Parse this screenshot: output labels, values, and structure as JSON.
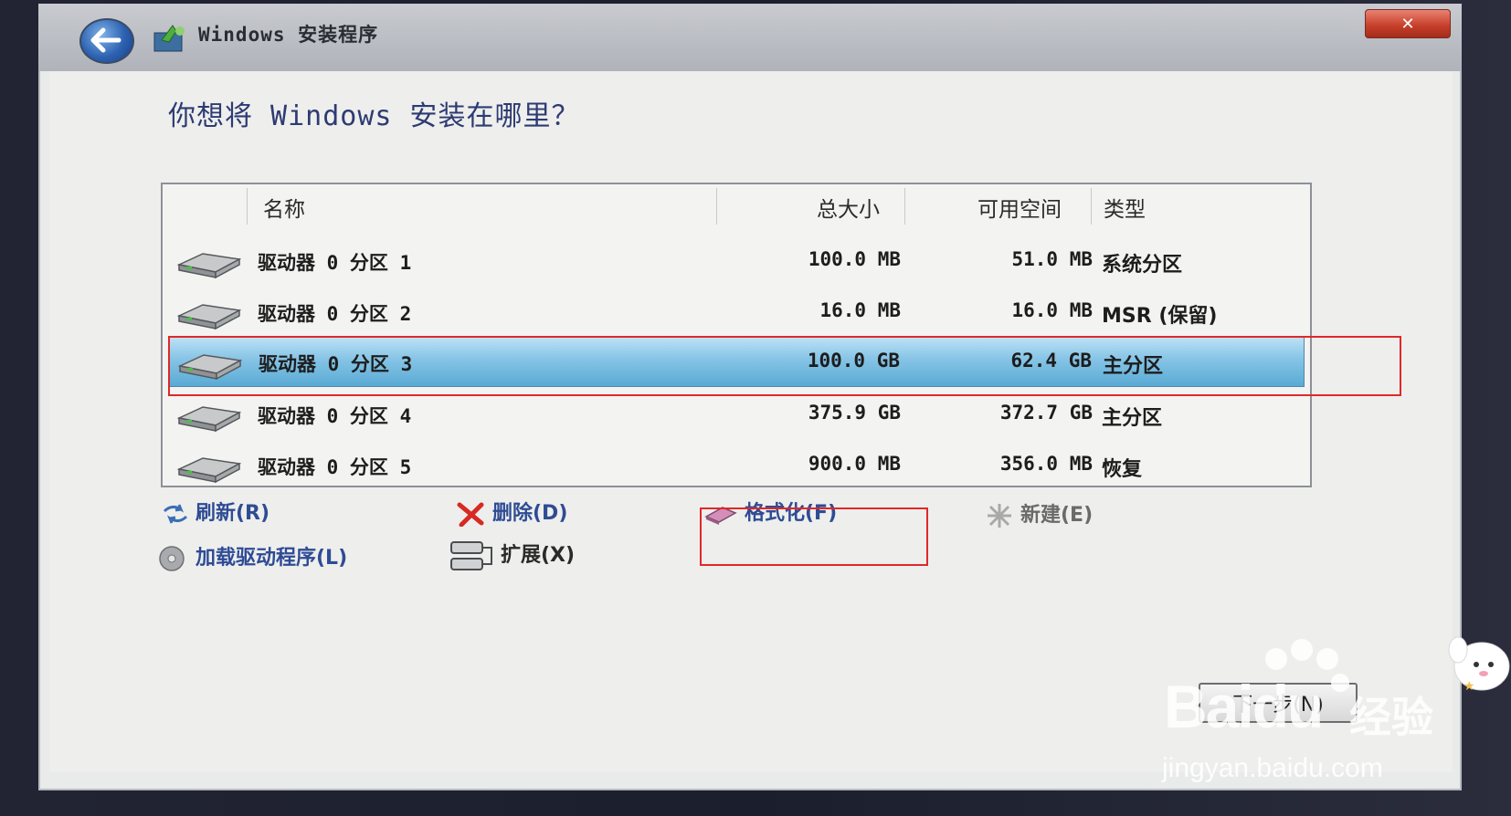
{
  "window": {
    "title": "Windows 安装程序",
    "close_label": "✕"
  },
  "page": {
    "heading": "你想将 Windows 安装在哪里？"
  },
  "table": {
    "columns": {
      "name": "名称",
      "total": "总大小",
      "free": "可用空间",
      "type": "类型"
    },
    "rows": [
      {
        "name": "驱动器 0 分区 1",
        "total": "100.0 MB",
        "free": "51.0 MB",
        "type": "系统分区",
        "selected": false
      },
      {
        "name": "驱动器 0 分区 2",
        "total": "16.0 MB",
        "free": "16.0 MB",
        "type": "MSR (保留)",
        "selected": false
      },
      {
        "name": "驱动器 0 分区 3",
        "total": "100.0 GB",
        "free": "62.4 GB",
        "type": "主分区",
        "selected": true
      },
      {
        "name": "驱动器 0 分区 4",
        "total": "375.9 GB",
        "free": "372.7 GB",
        "type": "主分区",
        "selected": false
      },
      {
        "name": "驱动器 0 分区 5",
        "total": "900.0 MB",
        "free": "356.0 MB",
        "type": "恢复",
        "selected": false
      }
    ]
  },
  "actions": {
    "refresh": "刷新(R)",
    "delete": "删除(D)",
    "format": "格式化(F)",
    "new": "新建(E)",
    "load_driver": "加载驱动程序(L)",
    "extend": "扩展(X)"
  },
  "next_label": "下一步(N)",
  "watermark": {
    "logo": "Baidu",
    "logo_cn": "经验",
    "url": "jingyan.baidu.com"
  },
  "colors": {
    "selection": "#86c4e6",
    "link": "#2e4c95",
    "highlight_box": "#e02828"
  }
}
